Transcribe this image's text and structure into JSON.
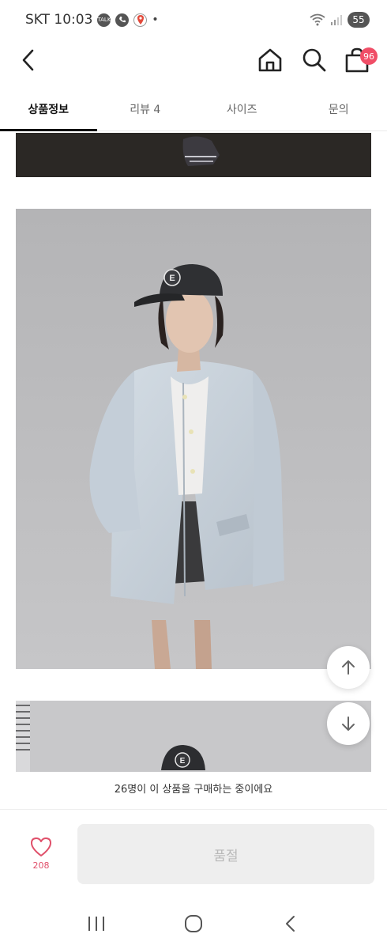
{
  "status_bar": {
    "carrier_time": "SKT 10:03",
    "notif_icons": [
      "chat-icon",
      "phone-icon",
      "location-icon"
    ],
    "battery": "55"
  },
  "header": {
    "cart_count": "96",
    "accent_color": "#f04e67"
  },
  "tabs": [
    {
      "label": "상품정보",
      "active": true
    },
    {
      "label": "리뷰 4",
      "active": false
    },
    {
      "label": "사이즈",
      "active": false
    },
    {
      "label": "문의",
      "active": false
    }
  ],
  "notice": "26명이 이 상품을 구매하는 중이에요",
  "action_bar": {
    "wish_count": "208",
    "main_button": "품절"
  }
}
